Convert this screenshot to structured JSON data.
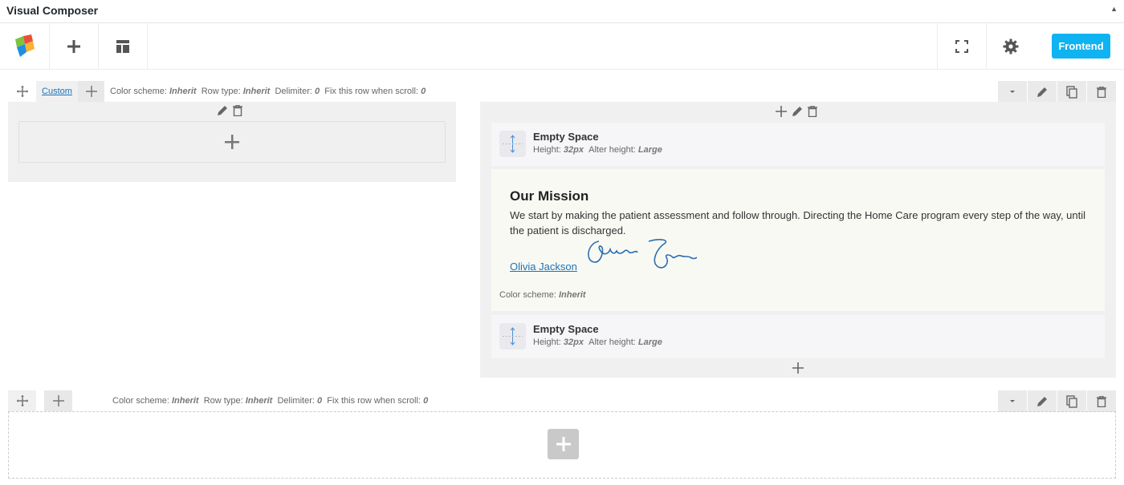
{
  "app": {
    "title": "Visual Composer",
    "collapse_glyph": "▲"
  },
  "toolbar": {
    "frontend_label": "Frontend",
    "icons": [
      "vc-logo-icon",
      "plus-icon",
      "layout-icon",
      "fullscreen-icon",
      "gear-icon"
    ]
  },
  "row1": {
    "custom_label": "Custom",
    "meta": {
      "color_scheme_label": "Color scheme:",
      "color_scheme_value": "Inherit",
      "row_type_label": "Row type:",
      "row_type_value": "Inherit",
      "delimiter_label": "Delimiter:",
      "delimiter_value": "0",
      "fix_label": "Fix this row when scroll:",
      "fix_value": "0"
    },
    "right_column": {
      "elements": [
        {
          "name": "Empty Space",
          "height_label": "Height:",
          "height_value": "32px",
          "alter_label": "Alter height:",
          "alter_value": "Large"
        },
        {
          "heading": "Our Mission",
          "paragraph": "We start by making the patient assessment and follow through. Directing the Home Care program every step of the way, until the patient is discharged.",
          "link": "Olivia Jackson",
          "color_scheme_label": "Color scheme:",
          "color_scheme_value": "Inherit"
        },
        {
          "name": "Empty Space",
          "height_label": "Height:",
          "height_value": "32px",
          "alter_label": "Alter height:",
          "alter_value": "Large"
        }
      ]
    }
  },
  "row2": {
    "meta": {
      "color_scheme_label": "Color scheme:",
      "color_scheme_value": "Inherit",
      "row_type_label": "Row type:",
      "row_type_value": "Inherit",
      "delimiter_label": "Delimiter:",
      "delimiter_value": "0",
      "fix_label": "Fix this row when scroll:",
      "fix_value": "0"
    }
  },
  "colors": {
    "accent": "#0fb3f2",
    "link": "#1a73b8"
  }
}
